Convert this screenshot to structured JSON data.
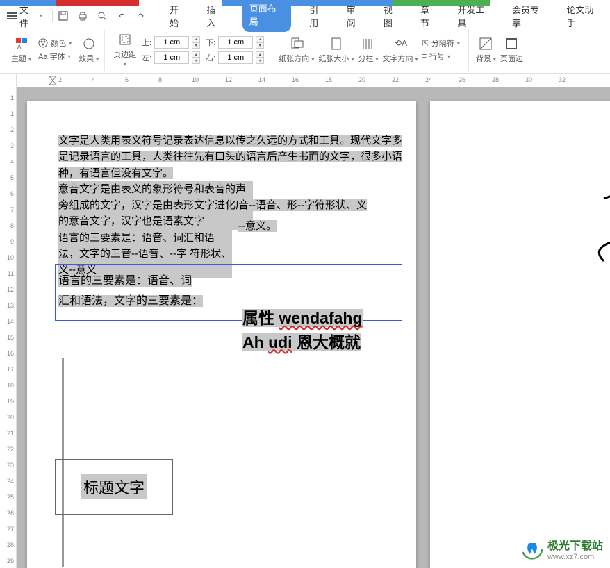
{
  "menu": {
    "file": "文件",
    "tabs": [
      "开始",
      "插入",
      "页面布局",
      "引用",
      "审阅",
      "视图",
      "章节",
      "开发工具",
      "会员专享",
      "论文助手"
    ],
    "active_index": 2
  },
  "ribbon": {
    "theme": "主题",
    "color": "颜色",
    "font": "Aa 字体",
    "effect": "效果",
    "margin": "页边距",
    "top_label": "上:",
    "bottom_label": "左:",
    "top_val": "1 cm",
    "bottom_val": "1 cm",
    "right_top_label": "下:",
    "right_bottom_label": "右:",
    "right_top_val": "1 cm",
    "right_bottom_val": "1 cm",
    "orientation": "纸张方向",
    "size": "纸张大小",
    "columns": "分栏",
    "text_dir": "文字方向",
    "break": "分隔符",
    "line_num": "行号",
    "background": "背景",
    "page_border": "页面边"
  },
  "ruler_h": [
    "2",
    "4",
    "6",
    "8",
    "10",
    "12",
    "14",
    "16",
    "18",
    "20",
    "22",
    "24",
    "26",
    "28",
    "30",
    "32"
  ],
  "ruler_v": [
    "1",
    "1",
    "2",
    "3",
    "4",
    "5",
    "6",
    "7",
    "8",
    "9",
    "10",
    "11",
    "12",
    "13",
    "14",
    "15",
    "16",
    "17",
    "18",
    "19",
    "20",
    "21",
    "22",
    "23",
    "24",
    "25",
    "26",
    "27",
    "28",
    "29"
  ],
  "doc": {
    "p1": "文字是人类用表义符号记录表达信息以传之久远的方式和工具。现代文字多是记录语言的工具，人类往往先有口头的语言后产生书面的文字，很多小语种，有语言但没有文字。",
    "p2": "意音文字是由表义的象形符号和表音的声旁组成的文字，汉字是由表形文字进化成的意音文字，汉字也是语素文字",
    "p3": "语言的三要素是：语音、词汇和语法，文字的三音--语音、--字 符形状、义--意义",
    "float1a": "音--语音、形--字符形状、义",
    "float1b": "--意义。",
    "sel1": "语言的三要素是：语音、词",
    "sel2": "汇和语法，文字的三要素是：",
    "big1_a": "属性 ",
    "big1_b": "wendafahg",
    "big2_a": "Ah ",
    "big2_b": "udi",
    "big2_c": " 恩大概就",
    "title": "标题文字"
  },
  "watermark": {
    "text1": "极光下载站",
    "text2": "www.xz7.com"
  },
  "icons": {
    "break": "⇱"
  }
}
